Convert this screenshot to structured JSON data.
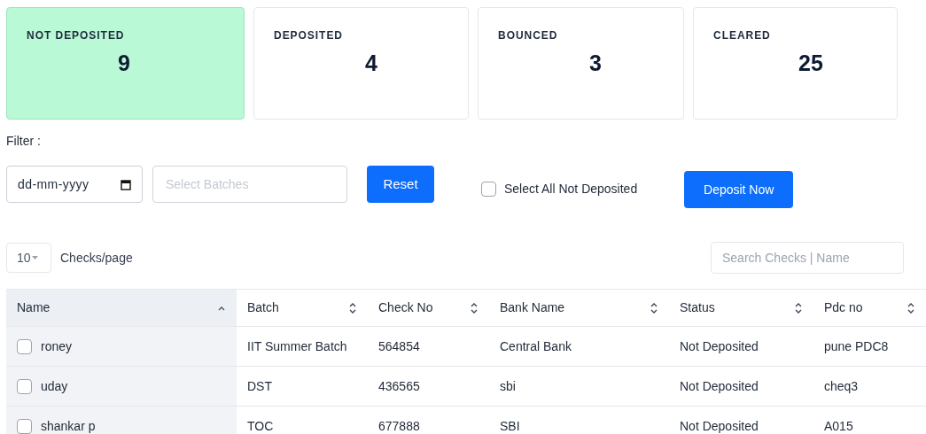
{
  "summary_cards": [
    {
      "label": "NOT DEPOSITED",
      "count": "9",
      "selected": true
    },
    {
      "label": "DEPOSITED",
      "count": "4",
      "selected": false
    },
    {
      "label": "BOUNCED",
      "count": "3",
      "selected": false
    },
    {
      "label": "CLEARED",
      "count": "25",
      "selected": false
    }
  ],
  "filter": {
    "label": "Filter :",
    "date_placeholder": "dd-mm-yyyy",
    "batches_placeholder": "Select Batches",
    "reset_button": "Reset",
    "select_all": {
      "label": "Select All Not Deposited",
      "checked": false
    },
    "deposit_button": "Deposit Now"
  },
  "pagination": {
    "page_size": "10",
    "page_size_label": "Checks/page"
  },
  "search": {
    "placeholder": "Search Checks | Name"
  },
  "table": {
    "columns": [
      {
        "label": "Name",
        "sorted": true
      },
      {
        "label": "Batch",
        "sorted": false
      },
      {
        "label": "Check No",
        "sorted": false
      },
      {
        "label": "Bank Name",
        "sorted": false
      },
      {
        "label": "Status",
        "sorted": false
      },
      {
        "label": "Pdc no",
        "sorted": false
      }
    ],
    "rows": [
      {
        "checked": false,
        "cells": [
          "roney",
          "IIT Summer Batch",
          "564854",
          "Central Bank",
          "Not Deposited",
          "pune PDC8"
        ]
      },
      {
        "checked": false,
        "cells": [
          "uday",
          "DST",
          "436565",
          "sbi",
          "Not Deposited",
          "cheq3"
        ]
      },
      {
        "checked": false,
        "cells": [
          "shankar p",
          "TOC",
          "677888",
          "SBI",
          "Not Deposited",
          "A015"
        ]
      }
    ]
  }
}
